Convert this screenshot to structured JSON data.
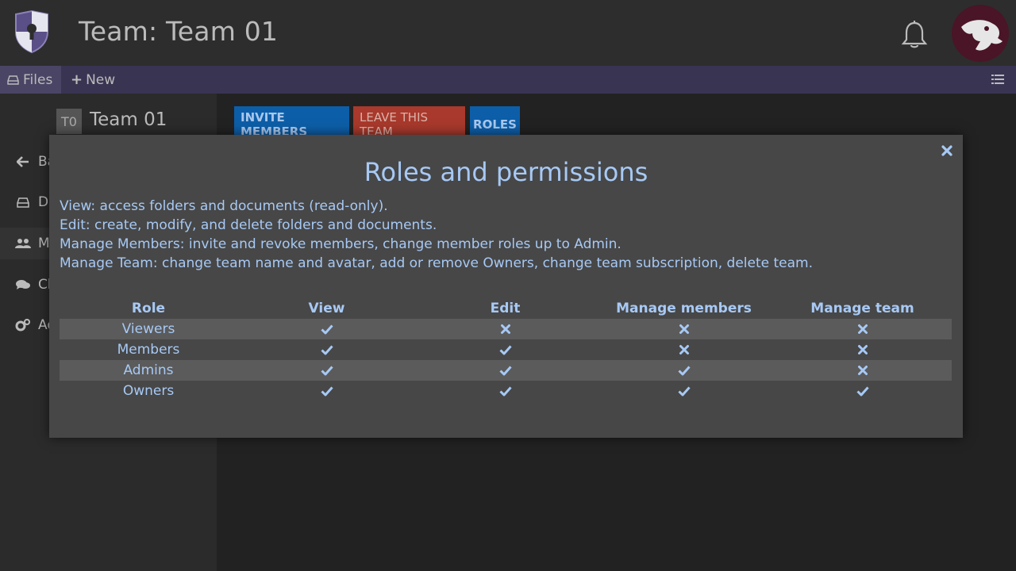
{
  "header": {
    "title": "Team: Team 01"
  },
  "toolbar": {
    "files_label": "Files",
    "new_label": "New"
  },
  "sidebar": {
    "team_badge": "T0",
    "team_name": "Team 01",
    "items": [
      {
        "label": "Ba",
        "icon": "arrow-left-icon"
      },
      {
        "label": "D",
        "icon": "drive-icon"
      },
      {
        "label": "M",
        "icon": "users-icon",
        "active": true
      },
      {
        "label": "Ch",
        "icon": "chat-icon"
      },
      {
        "label": "Ad",
        "icon": "gears-icon"
      }
    ]
  },
  "actions": {
    "invite": "INVITE MEMBERS",
    "leave": "LEAVE THIS TEAM",
    "roles": "ROLES"
  },
  "modal": {
    "title": "Roles and permissions",
    "descriptions": [
      "View: access folders and documents (read-only).",
      "Edit: create, modify, and delete folders and documents.",
      "Manage Members: invite and revoke members, change member roles up to Admin.",
      "Manage Team: change team name and avatar, add or remove Owners, change team subscription, delete team."
    ],
    "table": {
      "columns": [
        "Role",
        "View",
        "Edit",
        "Manage members",
        "Manage team"
      ],
      "rows": [
        {
          "role": "Viewers",
          "perms": [
            true,
            false,
            false,
            false
          ]
        },
        {
          "role": "Members",
          "perms": [
            true,
            true,
            false,
            false
          ]
        },
        {
          "role": "Admins",
          "perms": [
            true,
            true,
            true,
            false
          ]
        },
        {
          "role": "Owners",
          "perms": [
            true,
            true,
            true,
            true
          ]
        }
      ]
    }
  },
  "colors": {
    "accent_text": "#a7c9f5",
    "primary_button": "#0d5ea8",
    "danger_button": "#a8392c",
    "toolbar_bg": "#3a3453"
  }
}
